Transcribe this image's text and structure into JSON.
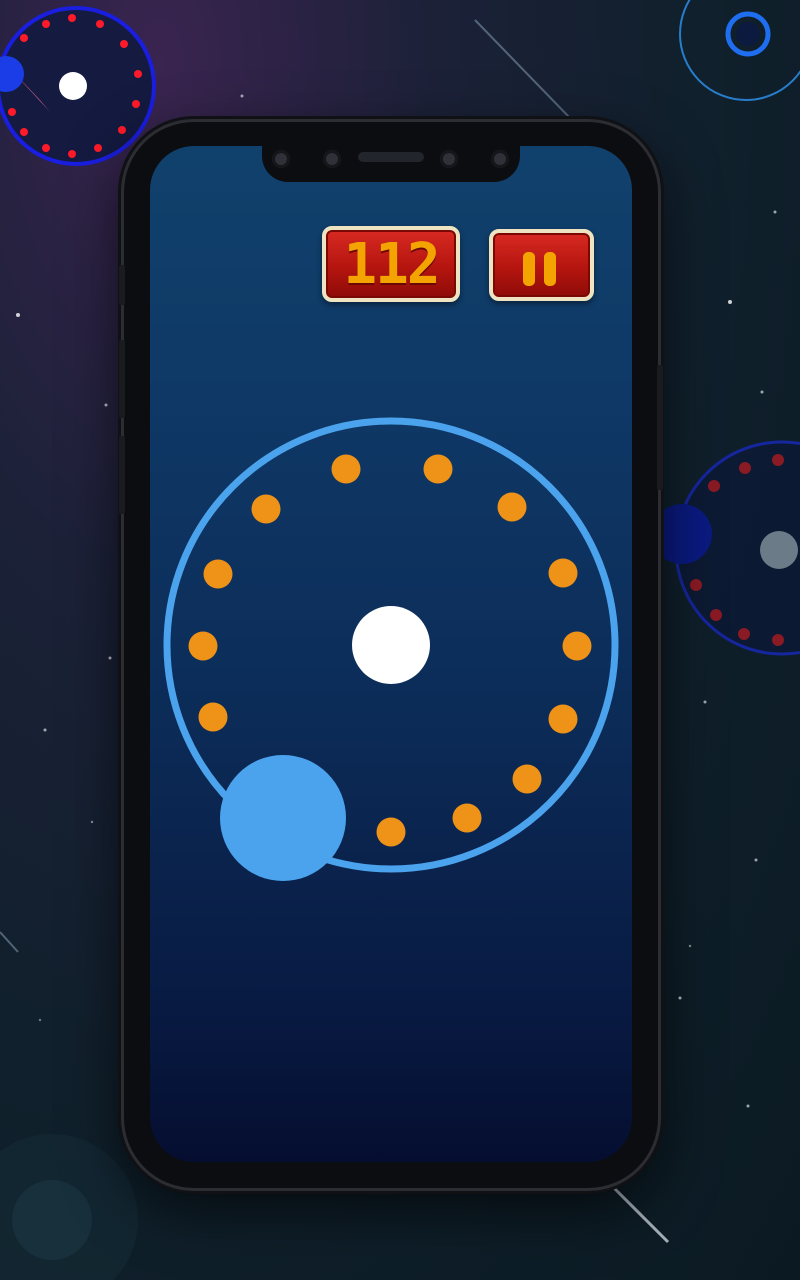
{
  "hud": {
    "score": "112",
    "pause_icon": "pause-icon"
  },
  "colors": {
    "ring": "#4aa3ec",
    "dot": "#ef9318",
    "center_ball": "#ffffff",
    "player_ball": "#4aa3ec",
    "hud_red": "#c41a14",
    "hud_digit": "#f3a400",
    "hud_border": "#efe4c2"
  },
  "game": {
    "orange_dot_count": 15
  }
}
